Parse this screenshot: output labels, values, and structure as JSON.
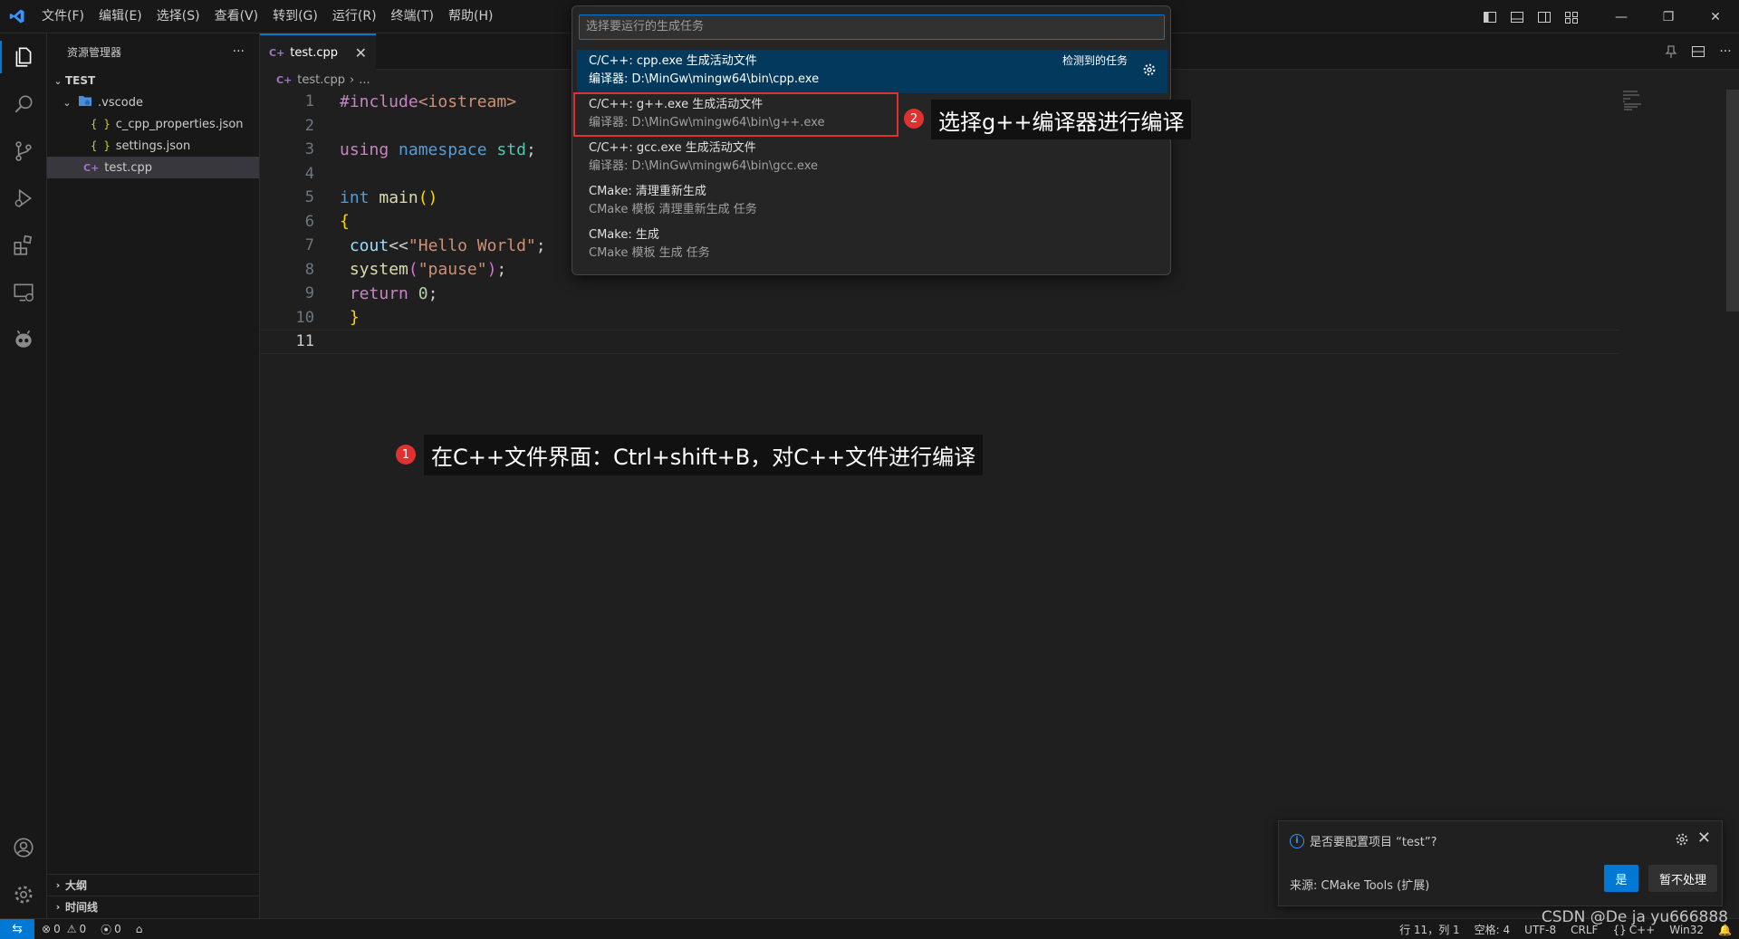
{
  "menubar": {
    "items": [
      "文件(F)",
      "编辑(E)",
      "选择(S)",
      "查看(V)",
      "转到(G)",
      "运行(R)",
      "终端(T)",
      "帮助(H)"
    ]
  },
  "sidebar": {
    "title": "资源管理器",
    "more": "···",
    "folder": "TEST",
    "subfolder": ".vscode",
    "files": [
      "c_cpp_properties.json",
      "settings.json"
    ],
    "active_file": "test.cpp",
    "outline": "大纲",
    "timeline": "时间线"
  },
  "editor": {
    "tab_label": "test.cpp",
    "breadcrumb_file": "test.cpp",
    "breadcrumb_more": "...",
    "line_numbers": [
      "1",
      "2",
      "3",
      "4",
      "5",
      "6",
      "7",
      "8",
      "9",
      "10",
      "11"
    ],
    "current_line": 11,
    "code": {
      "include_directive": "#include",
      "include_header": "<iostream>",
      "using_kw": "using",
      "namespace_kw": "namespace",
      "namespace_name": "std",
      "semicolon": ";",
      "int_kw": "int",
      "main_fn": "main",
      "parens": "()",
      "open_brace": "{",
      "cout": "cout",
      "shift_op": "<<",
      "hello": "\"Hello World\"",
      "system_fn": "system",
      "open_paren": "(",
      "close_paren": ")",
      "pause": "\"pause\"",
      "return_kw": "return",
      "zero": "0",
      "close_brace": "}"
    }
  },
  "quickpick": {
    "placeholder": "选择要运行的生成任务",
    "separator_label": "检测到的任务",
    "items": [
      {
        "label": "C/C++: cpp.exe 生成活动文件",
        "detail": "编译器: D:\\MinGw\\mingw64\\bin\\cpp.exe"
      },
      {
        "label": "C/C++: g++.exe 生成活动文件",
        "detail": "编译器: D:\\MinGw\\mingw64\\bin\\g++.exe"
      },
      {
        "label": "C/C++: gcc.exe 生成活动文件",
        "detail": "编译器: D:\\MinGw\\mingw64\\bin\\gcc.exe"
      },
      {
        "label": "CMake: 清理重新生成",
        "detail": "CMake 模板 清理重新生成 任务"
      },
      {
        "label": "CMake: 生成",
        "detail": "CMake 模板 生成 任务"
      }
    ]
  },
  "annotations": {
    "step1_badge": "1",
    "step1_text": "在C++文件界面：Ctrl+shift+B，对C++文件进行编译",
    "step2_badge": "2",
    "step2_text": "选择g++编译器进行编译"
  },
  "notification": {
    "message": "是否要配置项目 “test”?",
    "source": "来源: CMake Tools (扩展)",
    "primary": "是",
    "secondary": "暂不处理"
  },
  "statusbar": {
    "errors": "0",
    "warnings": "0",
    "ports": "0",
    "position": "行 11，列 1",
    "spaces": "空格: 4",
    "encoding": "UTF-8",
    "eol": "CRLF",
    "language": "C++",
    "platform": "Win32"
  },
  "watermark": "CSDN @De ja yu666888",
  "colors": {
    "accent": "#0078d4",
    "highlight": "#e03131"
  }
}
